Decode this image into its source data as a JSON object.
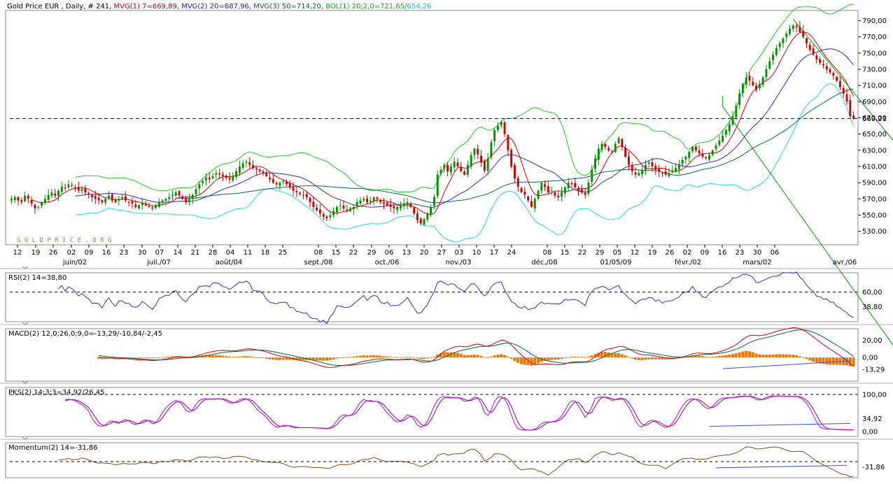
{
  "header": {
    "segments": [
      {
        "text": "Gold Price EUR  , Daily, # 241, ",
        "color": "#000000"
      },
      {
        "text": "MVG(1) 7=669,89, ",
        "color": "#cc0000"
      },
      {
        "text": "MVG(2) 20=687,96, ",
        "color": "#2020d0"
      },
      {
        "text": "MVG(3) 50=714,20, ",
        "color": "#006a3c"
      },
      {
        "text": "BOL(1) 20;2,0=721,65/",
        "color": "#00bb00"
      },
      {
        "text": "654,26",
        "color": "#00c8e8"
      }
    ]
  },
  "watermark": "G O L D P R I C E . O R G",
  "chart_data": [
    {
      "type": "candlestick",
      "title": "Gold Price EUR  , Daily, # 241",
      "bars": 241,
      "ylim": [
        515,
        800
      ],
      "yticks": [
        530,
        550,
        570,
        590,
        610,
        630,
        650,
        670,
        690,
        710,
        730,
        750,
        770,
        790
      ],
      "ytick_labels": [
        "530,00",
        "550,00",
        "570,00",
        "590,00",
        "610,00",
        "630,00",
        "650,00",
        "670,00",
        "690,00",
        "710,00",
        "730,00",
        "750,00",
        "770,00",
        "790,00"
      ],
      "last_value_label": "669,21",
      "reference_line": 669.21,
      "closes": [
        570,
        572,
        568,
        566,
        574,
        570,
        564,
        558,
        560,
        565,
        570,
        575,
        578,
        574,
        580,
        585,
        583,
        588,
        586,
        584,
        580,
        582,
        578,
        576,
        572,
        570,
        568,
        566,
        570,
        574,
        568,
        566,
        570,
        572,
        568,
        566,
        564,
        560,
        562,
        565,
        562,
        560,
        558,
        562,
        566,
        568,
        570,
        572,
        575,
        578,
        574,
        570,
        566,
        570,
        575,
        582,
        588,
        592,
        596,
        594,
        598,
        602,
        600,
        598,
        596,
        594,
        598,
        604,
        610,
        614,
        616,
        612,
        608,
        606,
        604,
        602,
        598,
        594,
        590,
        588,
        590,
        592,
        588,
        584,
        580,
        578,
        576,
        574,
        572,
        566,
        560,
        556,
        552,
        548,
        546,
        550,
        555,
        560,
        562,
        558,
        556,
        558,
        560,
        566,
        568,
        570,
        566,
        568,
        572,
        570,
        566,
        564,
        562,
        560,
        558,
        560,
        562,
        564,
        566,
        560,
        552,
        544,
        540,
        545,
        552,
        560,
        572,
        600,
        606,
        612,
        604,
        610,
        616,
        610,
        604,
        600,
        612,
        624,
        632,
        625,
        615,
        605,
        620,
        640,
        655,
        660,
        665,
        650,
        630,
        610,
        595,
        585,
        578,
        575,
        568,
        560,
        570,
        580,
        590,
        585,
        578,
        580,
        574,
        572,
        578,
        584,
        590,
        588,
        584,
        580,
        578,
        575,
        590,
        606,
        620,
        632,
        638,
        634,
        630,
        628,
        638,
        645,
        634,
        622,
        612,
        604,
        600,
        602,
        606,
        612,
        615,
        610,
        606,
        604,
        602,
        600,
        602,
        605,
        608,
        612,
        618,
        622,
        628,
        634,
        630,
        626,
        622,
        620,
        624,
        630,
        636,
        642,
        648,
        655,
        662,
        672,
        685,
        700,
        712,
        720,
        716,
        710,
        705,
        712,
        720,
        730,
        740,
        748,
        756,
        762,
        768,
        774,
        780,
        784,
        782,
        776,
        770,
        762,
        754,
        748,
        742,
        738,
        735,
        730,
        726,
        722,
        716,
        708,
        700,
        690,
        672,
        669
      ]
    },
    {
      "type": "line",
      "title": "RSI(2) 14=38,80",
      "ylim": [
        0,
        100
      ],
      "yticks": [
        60
      ],
      "ytick_labels": [
        "60,00"
      ],
      "reference_line": 60,
      "last_value_label": "38,80"
    },
    {
      "type": "line",
      "title": "MACD(2) 12,0;26,0;9,0=-13,29/-10,84/-2,45",
      "ylim": [
        -25,
        30
      ],
      "yticks": [
        20,
        0
      ],
      "ytick_labels": [
        "20,00",
        "0,00"
      ],
      "reference_line": 0,
      "last_value_label": "-13,29"
    },
    {
      "type": "line",
      "title": "PKS(2) 14;3;3=34,92/26,45",
      "ylim": [
        -5,
        105
      ],
      "yticks": [
        100,
        0
      ],
      "ytick_labels": [
        "100,00",
        "0,00"
      ],
      "reference_line": 100,
      "last_value_label": "34,92"
    },
    {
      "type": "line",
      "title": "Momentum(2) 14=-31,86",
      "ylim": [
        -90,
        90
      ],
      "yticks": [],
      "ytick_labels": [],
      "reference_line": 0,
      "last_value_label": "-31,86"
    }
  ],
  "x_axis": {
    "day_labels": [
      "12",
      "19",
      "26",
      "02",
      "09",
      "16",
      "23",
      "30",
      "07",
      "14",
      "21",
      "28",
      "04",
      "11",
      "18",
      "25",
      "08",
      "15",
      "22",
      "29",
      "06",
      "13",
      "20",
      "27",
      "03",
      "10",
      "17",
      "24",
      "08",
      "15",
      "22",
      "29",
      "05",
      "12",
      "19",
      "26",
      "02",
      "09",
      "16",
      "23",
      "30",
      "06"
    ],
    "month_labels": [
      "juin/02",
      "juil./07",
      "août/04",
      "sept./08",
      "oct./06",
      "nov./03",
      "déc./08",
      "01/05/09",
      "févr./02",
      "mars/02",
      "avr./06"
    ]
  },
  "colors": {
    "price_up": "#009000",
    "price_down": "#d00000",
    "ma7": "#d40000",
    "ma20": "#2b2bcf",
    "ma50": "#007040",
    "boll_upper": "#22cc22",
    "boll_lower": "#22d8f0",
    "reference": "#0000c0",
    "rsi": "#3030d0",
    "macd": "#d00000",
    "macd_signal": "#006a3c",
    "macd_hist": "#f07800",
    "pks_main": "#c800c8",
    "pks_signal": "#7a00c8",
    "momentum": "#8a4a10",
    "trend_channel": "#00a000",
    "trend_line": "#3050e0"
  }
}
